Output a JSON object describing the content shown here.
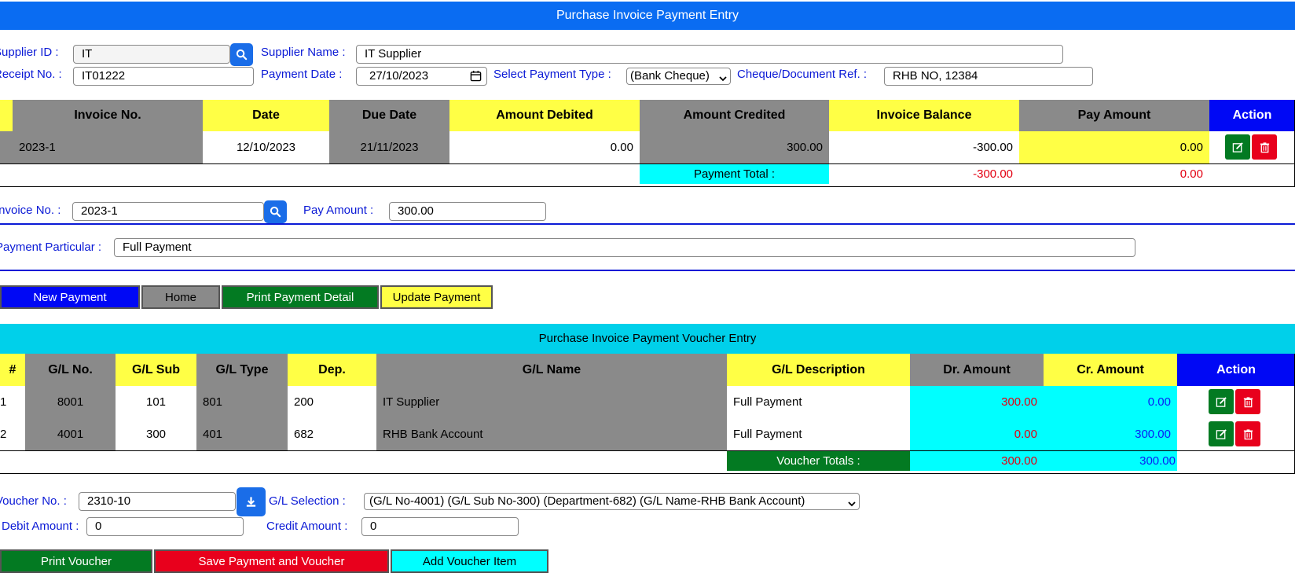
{
  "header": {
    "title": "Purchase Invoice Payment Entry"
  },
  "supplier": {
    "id_label": "Supplier ID :",
    "id_value": "IT",
    "name_label": "Supplier Name :",
    "name_value": "IT Supplier",
    "receipt_label": "Receipt No. :",
    "receipt_value": "IT01222",
    "date_label": "Payment Date :",
    "date_value": "27/10/2023",
    "type_label": "Select Payment Type :",
    "type_value": "(Bank Cheque)",
    "ref_label": "Cheque/Document Ref. :",
    "ref_value": "RHB NO, 12384"
  },
  "invoice_table": {
    "headers": [
      "Invoice No.",
      "Date",
      "Due Date",
      "Amount Debited",
      "Amount Credited",
      "Invoice Balance",
      "Pay Amount",
      "Action"
    ],
    "rows": [
      {
        "invoice_no": "2023-1",
        "date": "12/10/2023",
        "due_date": "21/11/2023",
        "debited": "0.00",
        "credited": "300.00",
        "balance": "-300.00",
        "pay": "0.00"
      }
    ],
    "total_label": "Payment Total :",
    "total_balance": "-300.00",
    "total_pay": "0.00"
  },
  "payment_form": {
    "invoice_label": "Invoice No. :",
    "invoice_value": "2023-1",
    "pay_label": "Pay Amount :",
    "pay_value": "300.00",
    "particular_label": "Payment Particular :",
    "particular_value": "Full Payment"
  },
  "buttons": {
    "new_payment": "New Payment",
    "home": "Home",
    "print_detail": "Print Payment Detail",
    "update": "Update Payment",
    "print_voucher": "Print Voucher",
    "save": "Save Payment and Voucher",
    "add_item": "Add Voucher Item"
  },
  "voucher_section": {
    "title": "Purchase Invoice Payment Voucher Entry"
  },
  "voucher_table": {
    "headers": [
      "#",
      "G/L No.",
      "G/L Sub",
      "G/L Type",
      "Dep.",
      "G/L Name",
      "G/L Description",
      "Dr. Amount",
      "Cr. Amount",
      "Action"
    ],
    "rows": [
      {
        "num": "1",
        "gl_no": "8001",
        "gl_sub": "101",
        "gl_type": "801",
        "dep": "200",
        "gl_name": "IT Supplier",
        "desc": "Full Payment",
        "dr": "300.00",
        "cr": "0.00"
      },
      {
        "num": "2",
        "gl_no": "4001",
        "gl_sub": "300",
        "gl_type": "401",
        "dep": "682",
        "gl_name": "RHB Bank Account",
        "desc": "Full Payment",
        "dr": "0.00",
        "cr": "300.00"
      }
    ],
    "totals_label": "Voucher Totals :",
    "total_dr": "300.00",
    "total_cr": "300.00"
  },
  "voucher_form": {
    "voucher_label": "Voucher No. :",
    "voucher_value": "2310-10",
    "gl_label": "G/L Selection :",
    "gl_value": "(G/L No-4001) (G/L Sub No-300) (Department-682) (G/L Name-RHB Bank Account)",
    "debit_label": "Debit Amount :",
    "debit_value": "0",
    "credit_label": "Credit Amount :",
    "credit_value": "0"
  },
  "colors": {
    "primary": "#0a6cf2",
    "header_grey": "#8a8a8a",
    "header_yellow": "#ffff45",
    "action_blue": "#0008f5",
    "cyan": "#00ffff",
    "green": "#037a22",
    "red": "#e8001c"
  }
}
